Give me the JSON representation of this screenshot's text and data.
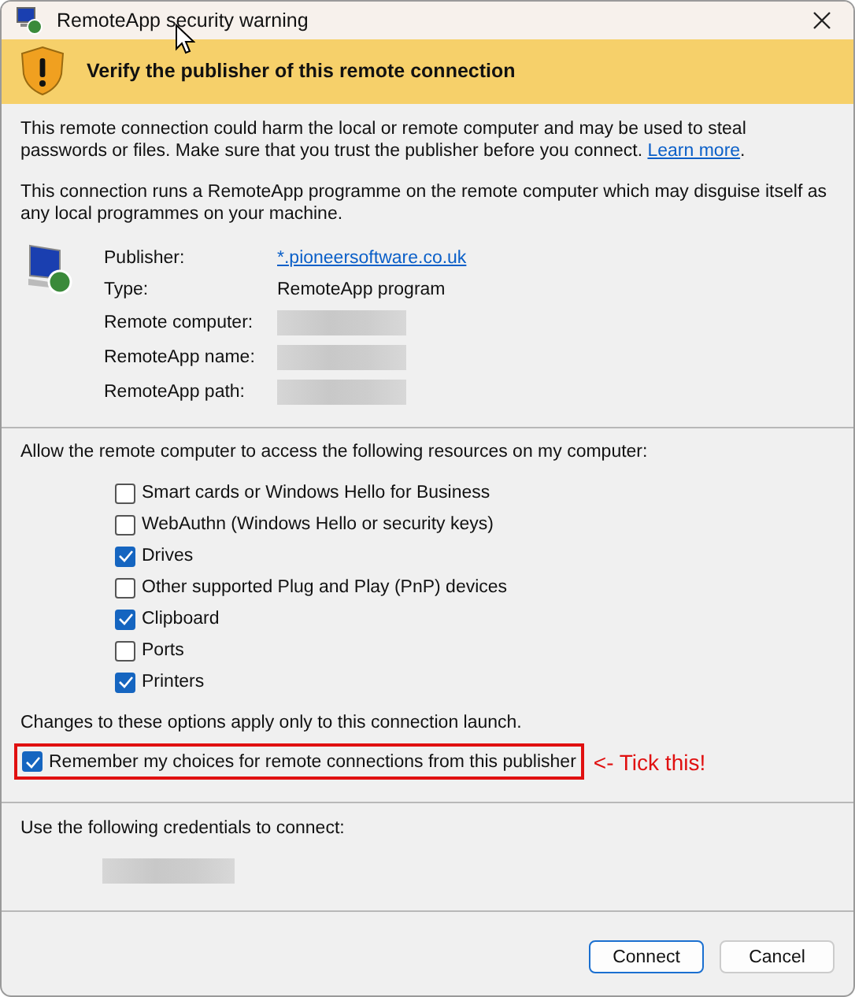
{
  "window": {
    "title": "RemoteApp security warning"
  },
  "banner": {
    "heading": "Verify the publisher of this remote connection"
  },
  "warning": {
    "text": "This remote connection could harm the local or remote computer and may be used to steal passwords or files. Make sure that you trust the publisher before you connect.",
    "link": "Learn more",
    "after": "."
  },
  "description": "This connection runs a RemoteApp programme on the remote computer which may disguise itself as any local programmes on your machine.",
  "details": [
    {
      "label": "Publisher:",
      "kind": "link",
      "value": "*.pioneersoftware.co.uk"
    },
    {
      "label": "Type:",
      "kind": "text",
      "value": "RemoteApp program"
    },
    {
      "label": "Remote computer:",
      "kind": "redacted"
    },
    {
      "label": "RemoteApp name:",
      "kind": "redacted"
    },
    {
      "label": "RemoteApp path:",
      "kind": "redacted"
    }
  ],
  "resources": {
    "heading": "Allow the remote computer to access the following resources on my computer:",
    "items": [
      {
        "label": "Smart cards or Windows Hello for Business",
        "checked": false
      },
      {
        "label": "WebAuthn (Windows Hello or security keys)",
        "checked": false
      },
      {
        "label": "Drives",
        "checked": true
      },
      {
        "label": "Other supported Plug and Play (PnP) devices",
        "checked": false
      },
      {
        "label": "Clipboard",
        "checked": true
      },
      {
        "label": "Ports",
        "checked": false
      },
      {
        "label": "Printers",
        "checked": true
      }
    ]
  },
  "note": "Changes to these options apply only to this connection launch.",
  "remember": {
    "label": "Remember my choices for remote connections from this publisher",
    "checked": true,
    "highlighted": true,
    "annotation": "<- Tick this!"
  },
  "credentials": {
    "heading": "Use the following credentials to connect:"
  },
  "buttons": [
    {
      "label": "Connect",
      "default": true
    },
    {
      "label": "Cancel",
      "default": false
    }
  ]
}
